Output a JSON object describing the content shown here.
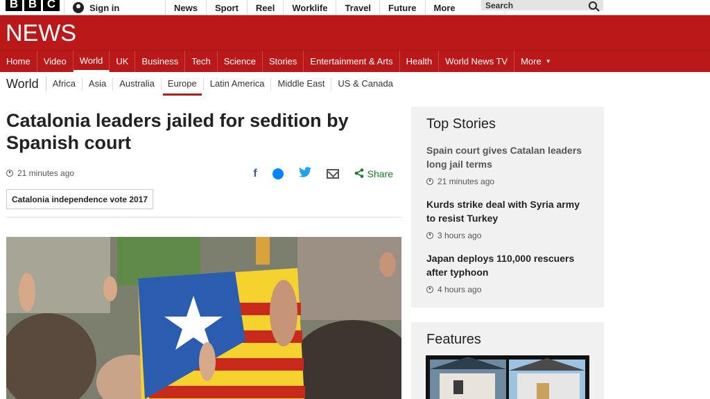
{
  "header": {
    "logo_letters": [
      "B",
      "B",
      "C"
    ],
    "signin_label": "Sign in",
    "top_nav": [
      "News",
      "Sport",
      "Reel",
      "Worklife",
      "Travel",
      "Future"
    ],
    "more_label": "More",
    "search_label": "Search"
  },
  "banner": {
    "title": "NEWS"
  },
  "main_nav": {
    "items": [
      "Home",
      "Video",
      "World",
      "UK",
      "Business",
      "Tech",
      "Science",
      "Stories",
      "Entertainment & Arts",
      "Health",
      "World News TV"
    ],
    "more_label": "More",
    "active": "World"
  },
  "sub_nav": {
    "section_title": "World",
    "items": [
      "Africa",
      "Asia",
      "Australia",
      "Europe",
      "Latin America",
      "Middle East",
      "US & Canada"
    ],
    "active": "Europe"
  },
  "article": {
    "headline": "Catalonia leaders jailed for sedition by Spanish court",
    "time": "21 minutes ago",
    "share_label": "Share",
    "tag": "Catalonia independence vote 2017"
  },
  "sidebar": {
    "top_stories_title": "Top Stories",
    "stories": [
      {
        "title": "Spain court gives Catalan leaders long jail terms",
        "time": "21 minutes ago"
      },
      {
        "title": "Kurds strike deal with Syria army to resist Turkey",
        "time": "3 hours ago"
      },
      {
        "title": "Japan deploys 110,000 rescuers after typhoon",
        "time": "4 hours ago"
      }
    ],
    "features_title": "Features"
  },
  "colors": {
    "brand_red": "#bb1919",
    "share_green": "#1a7a28"
  }
}
